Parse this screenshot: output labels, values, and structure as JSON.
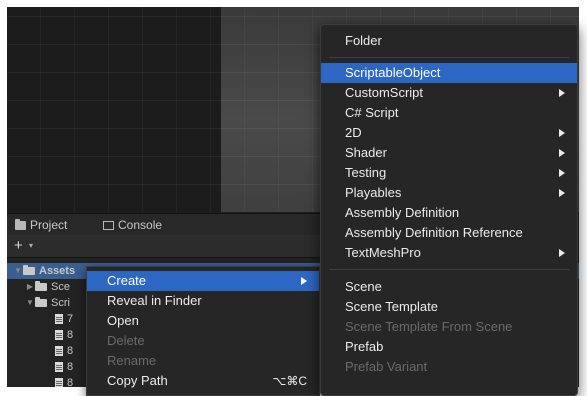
{
  "scene": {},
  "panel": {
    "tabs": [
      {
        "label": "Project",
        "icon": "folder-icon"
      },
      {
        "label": "Console",
        "icon": "console-icon"
      }
    ],
    "toolbar": {
      "add_label": "+",
      "caret": "▾"
    }
  },
  "tree": {
    "assets_label": "Assets",
    "rows": [
      {
        "label": "Sce"
      },
      {
        "label": "Scri"
      },
      {
        "label": "7"
      },
      {
        "label": "8"
      },
      {
        "label": "8"
      },
      {
        "label": "8"
      },
      {
        "label": "8"
      }
    ]
  },
  "context_menu": {
    "items": [
      {
        "label": "Create",
        "state": "highlighted",
        "has_submenu": true
      },
      {
        "label": "Reveal in Finder",
        "state": "enabled"
      },
      {
        "label": "Open",
        "state": "enabled"
      },
      {
        "label": "Delete",
        "state": "disabled"
      },
      {
        "label": "Rename",
        "state": "disabled"
      },
      {
        "label": "Copy Path",
        "state": "enabled",
        "shortcut": "⌥⌘C"
      }
    ]
  },
  "submenu": {
    "items": [
      {
        "label": "Folder",
        "state": "enabled"
      },
      {
        "label": "ScriptableObject",
        "state": "highlighted"
      },
      {
        "label": "CustomScript",
        "state": "enabled",
        "has_submenu": true
      },
      {
        "label": "C# Script",
        "state": "enabled"
      },
      {
        "label": "2D",
        "state": "enabled",
        "has_submenu": true
      },
      {
        "label": "Shader",
        "state": "enabled",
        "has_submenu": true
      },
      {
        "label": "Testing",
        "state": "enabled",
        "has_submenu": true
      },
      {
        "label": "Playables",
        "state": "enabled",
        "has_submenu": true
      },
      {
        "label": "Assembly Definition",
        "state": "enabled"
      },
      {
        "label": "Assembly Definition Reference",
        "state": "enabled"
      },
      {
        "label": "TextMeshPro",
        "state": "enabled",
        "has_submenu": true
      },
      {
        "label": "Scene",
        "state": "enabled"
      },
      {
        "label": "Scene Template",
        "state": "enabled"
      },
      {
        "label": "Scene Template From Scene",
        "state": "disabled"
      },
      {
        "label": "Prefab",
        "state": "enabled"
      },
      {
        "label": "Prefab Variant",
        "state": "disabled"
      }
    ]
  },
  "colors": {
    "highlight": "#2d67c4",
    "menu_bg": "#262626",
    "disabled_text": "#6a6a6a"
  }
}
